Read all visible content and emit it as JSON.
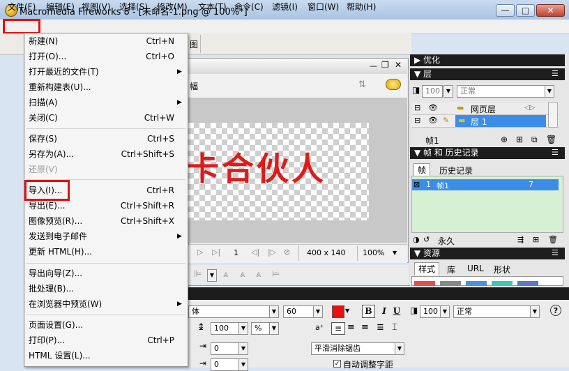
{
  "window": {
    "title": "Macromedia Fireworks 8 - [未命名-1.png @ 100%*]",
    "min_glyph": "—",
    "max_glyph": "□",
    "close_glyph": "✕"
  },
  "menubar": [
    "文件(F)",
    "编辑(E)",
    "视图(V)",
    "选择(S)",
    "修改(M)",
    "文本(T)",
    "命令(C)",
    "滤镜(I)",
    "窗口(W)",
    "帮助(H)"
  ],
  "file_menu": {
    "items": [
      {
        "label": "新建(N)",
        "shortcut": "Ctrl+N"
      },
      {
        "label": "打开(O)...",
        "shortcut": "Ctrl+O"
      },
      {
        "label": "打开最近的文件(T)",
        "submenu": true
      },
      {
        "label": "重新构建表(U)..."
      },
      {
        "label": "扫描(A)",
        "submenu": true
      },
      {
        "label": "关闭(C)",
        "shortcut": "Ctrl+W"
      },
      {
        "label": "保存(S)",
        "shortcut": "Ctrl+S"
      },
      {
        "label": "另存为(A)...",
        "shortcut": "Ctrl+Shift+S"
      },
      {
        "label": "还原(V)",
        "disabled": true
      },
      {
        "label": "导入(I)...",
        "shortcut": "Ctrl+R",
        "highlighted": true
      },
      {
        "label": "导出(E)...",
        "shortcut": "Ctrl+Shift+R"
      },
      {
        "label": "图像预览(R)...",
        "shortcut": "Ctrl+Shift+X"
      },
      {
        "label": "发送到电子邮件",
        "submenu": true
      },
      {
        "label": "更新 HTML(H)..."
      },
      {
        "label": "导出向导(Z)..."
      },
      {
        "label": "批处理(B)..."
      },
      {
        "label": "在浏览器中预览(W)",
        "submenu": true
      },
      {
        "label": "页面设置(G)..."
      },
      {
        "label": "打印(P)...",
        "shortcut": "Ctrl+P"
      },
      {
        "label": "HTML 设置(L)..."
      }
    ]
  },
  "document": {
    "tab_partial": "幅",
    "canvas_text": "卡合伙人",
    "frame_number": "1",
    "canvas_size": "400 x 140",
    "zoom": "100%"
  },
  "toolbar": {
    "partial_label": "图"
  },
  "panels": {
    "optimize": "优化",
    "layers": "层",
    "layer_opacity": "100",
    "layer_blend": "正常",
    "layer_web": "网页层",
    "layer_1": "层 1",
    "frame_label": "帧1",
    "frames_history": "帧 和 历史记录",
    "tab_frames": "帧",
    "tab_history": "历史记录",
    "frame_row_index": "1",
    "frame_row_name": "帧1",
    "frame_row_delay": "7",
    "loop": "永久",
    "assets": "资源",
    "tab_styles": "样式",
    "tab_library": "库",
    "tab_url": "URL",
    "tab_shapes": "形状"
  },
  "properties": {
    "font_partial": "体",
    "font_size": "60",
    "color": "#e81010",
    "bold": "B",
    "italic": "I",
    "underline": "U",
    "opacity": "100",
    "blend": "正常",
    "leading": "100",
    "leading_unit": "%",
    "indent": "0",
    "space": "0",
    "antialias": "平滑消除锯齿",
    "auto_kern": "自动调整字距",
    "help": "?"
  }
}
